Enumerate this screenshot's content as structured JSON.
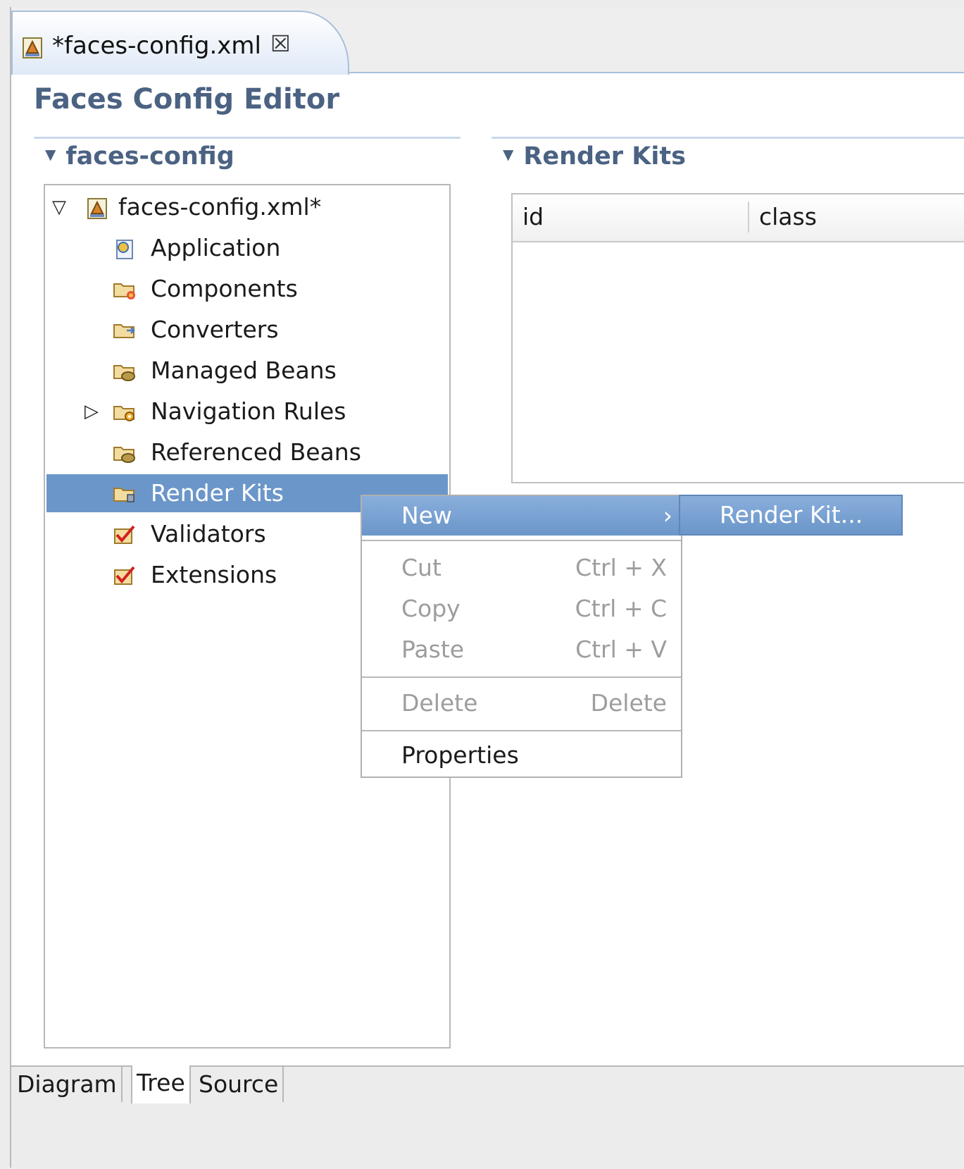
{
  "editor_tab": {
    "label": "*faces-config.xml",
    "close_glyph": "☒"
  },
  "page_title": "Faces Config Editor",
  "left_section": {
    "title": "faces-config"
  },
  "right_section": {
    "title": "Render Kits"
  },
  "tree": {
    "root": {
      "label": "faces-config.xml*",
      "icon": "faces-file-icon"
    },
    "items": [
      {
        "label": "Application",
        "icon": "application-icon"
      },
      {
        "label": "Components",
        "icon": "components-folder-icon"
      },
      {
        "label": "Converters",
        "icon": "converters-folder-icon"
      },
      {
        "label": "Managed Beans",
        "icon": "managed-beans-folder-icon"
      },
      {
        "label": "Navigation Rules",
        "icon": "navigation-rules-folder-icon"
      },
      {
        "label": "Referenced Beans",
        "icon": "referenced-beans-folder-icon"
      },
      {
        "label": "Render Kits",
        "icon": "render-kits-folder-icon",
        "selected": true
      },
      {
        "label": "Validators",
        "icon": "validators-check-icon"
      },
      {
        "label": "Extensions",
        "icon": "extensions-check-icon"
      }
    ]
  },
  "table": {
    "columns": [
      "id",
      "class"
    ]
  },
  "context_menu": {
    "new": "New",
    "cut": {
      "label": "Cut",
      "shortcut": "Ctrl + X"
    },
    "copy": {
      "label": "Copy",
      "shortcut": "Ctrl + C"
    },
    "paste": {
      "label": "Paste",
      "shortcut": "Ctrl + V"
    },
    "delete": {
      "label": "Delete",
      "shortcut": "Delete"
    },
    "properties": "Properties",
    "submenu_item": "Render Kit..."
  },
  "bottom_tabs": [
    "Diagram",
    "Tree",
    "Source"
  ],
  "active_bottom_tab": "Tree",
  "colors": {
    "accent": "#4b6282",
    "selection": "#6b96c9"
  }
}
